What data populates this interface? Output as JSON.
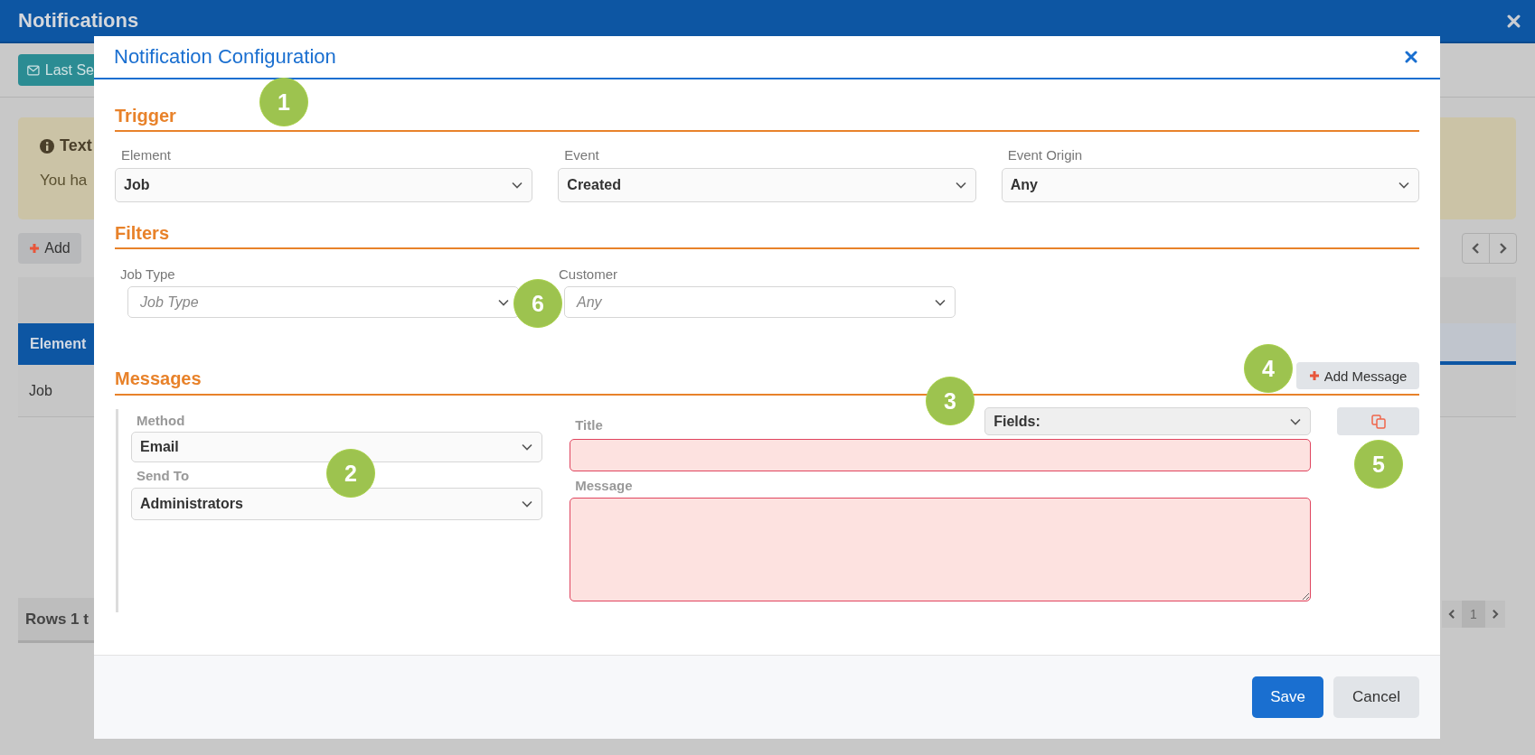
{
  "window": {
    "title": "Notifications"
  },
  "background": {
    "toolbar_button": "Last Se",
    "alert": {
      "title": "Text",
      "body": "You ha"
    },
    "add_button": "Add",
    "table": {
      "columns": [
        "Element"
      ],
      "rows": [
        [
          "Job"
        ]
      ]
    },
    "footer": "Rows 1 t",
    "page": "1"
  },
  "dialog": {
    "title": "Notification Configuration",
    "trigger": {
      "heading": "Trigger",
      "fields": [
        {
          "label": "Element",
          "value": "Job"
        },
        {
          "label": "Event",
          "value": "Created"
        },
        {
          "label": "Event Origin",
          "value": "Any"
        }
      ]
    },
    "filters": {
      "heading": "Filters",
      "fields": [
        {
          "label": "Job Type",
          "placeholder": "Job Type"
        },
        {
          "label": "Customer",
          "placeholder": "Any"
        }
      ]
    },
    "messages": {
      "heading": "Messages",
      "add_button": "Add Message",
      "method": {
        "label": "Method",
        "value": "Email"
      },
      "send_to": {
        "label": "Send To",
        "value": "Administrators"
      },
      "fields_select": "Fields:",
      "title": {
        "label": "Title",
        "invalid": true
      },
      "message": {
        "label": "Message",
        "invalid": true
      }
    },
    "buttons": [
      {
        "label": "Save",
        "kind": "primary"
      },
      {
        "label": "Cancel",
        "kind": "secondary"
      }
    ]
  },
  "callouts": [
    "1",
    "2",
    "3",
    "4",
    "5",
    "6"
  ]
}
